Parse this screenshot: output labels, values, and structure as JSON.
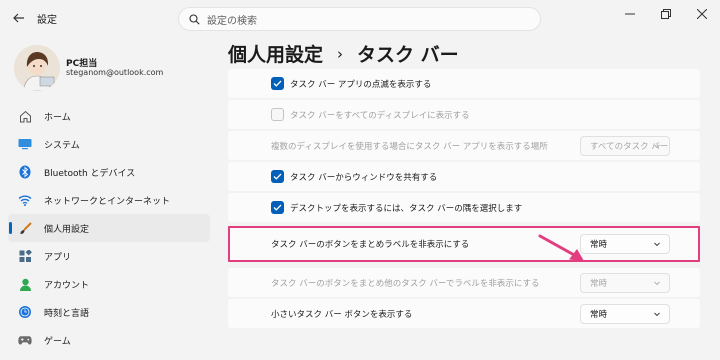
{
  "app": {
    "title": "設定"
  },
  "search": {
    "placeholder": "設定の検索"
  },
  "user": {
    "name": "PC担当",
    "email": "steganom@outlook.com"
  },
  "sidebar": {
    "items": [
      {
        "label": "ホーム",
        "icon": "home-icon"
      },
      {
        "label": "システム",
        "icon": "system-icon"
      },
      {
        "label": "Bluetooth とデバイス",
        "icon": "bluetooth-icon"
      },
      {
        "label": "ネットワークとインターネット",
        "icon": "wifi-icon"
      },
      {
        "label": "個人用設定",
        "icon": "brush-icon",
        "active": true
      },
      {
        "label": "アプリ",
        "icon": "apps-icon"
      },
      {
        "label": "アカウント",
        "icon": "account-icon"
      },
      {
        "label": "時刻と言語",
        "icon": "time-language-icon"
      },
      {
        "label": "ゲーム",
        "icon": "gaming-icon"
      }
    ]
  },
  "header": {
    "parent": "個人用設定",
    "separator": "›",
    "current": "タスク バー"
  },
  "settings": {
    "rows": [
      {
        "label": "タスク バー アプリの点滅を表示する",
        "checked": true,
        "disabled": false
      },
      {
        "label": "タスク バーをすべてのディスプレイに表示する",
        "checked": false,
        "disabled": true
      },
      {
        "label": "複数のディスプレイを使用する場合にタスク バー アプリを表示する場所",
        "dropdown": "すべてのタスク バー",
        "disabled": true
      },
      {
        "label": "タスク バーからウィンドウを共有する",
        "checked": true,
        "disabled": false
      },
      {
        "label": "デスクトップを表示するには、タスク バーの隅を選択します",
        "checked": true,
        "disabled": false
      },
      {
        "label": "タスク バーのボタンをまとめラベルを非表示にする",
        "dropdown": "常時",
        "disabled": false,
        "highlighted": true
      },
      {
        "label": "タスク バーのボタンをまとめ他のタスク バーでラベルを非表示にする",
        "dropdown": "常時",
        "disabled": true
      },
      {
        "label": "小さいタスク バー ボタンを表示する",
        "dropdown": "常時",
        "disabled": false
      }
    ]
  },
  "colors": {
    "accent": "#005fb8",
    "highlight": "#e33d80",
    "background": "#f3f3f3",
    "card": "#fbfbfb"
  }
}
